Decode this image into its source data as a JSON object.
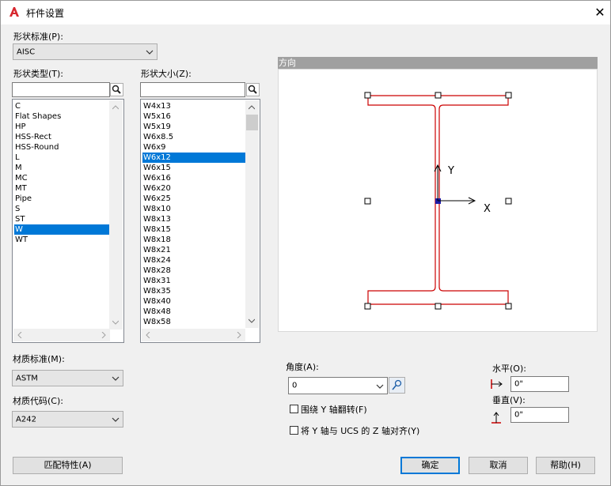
{
  "window": {
    "title": "杆件设置",
    "close_label": "✕"
  },
  "shape_standard": {
    "label": "形状标准(P):",
    "value": "AISC"
  },
  "shape_type": {
    "label": "形状类型(T):",
    "search_value": "",
    "items": [
      "C",
      "Flat Shapes",
      "HP",
      "HSS-Rect",
      "HSS-Round",
      "L",
      "M",
      "MC",
      "MT",
      "Pipe",
      "S",
      "ST",
      "W",
      "WT"
    ],
    "selected": "W"
  },
  "shape_size": {
    "label": "形状大小(Z):",
    "search_value": "",
    "items": [
      "W4x13",
      "W5x16",
      "W5x19",
      "W6x8.5",
      "W6x9",
      "W6x12",
      "W6x15",
      "W6x16",
      "W6x20",
      "W6x25",
      "W8x10",
      "W8x13",
      "W8x15",
      "W8x18",
      "W8x21",
      "W8x24",
      "W8x28",
      "W8x31",
      "W8x35",
      "W8x40",
      "W8x48",
      "W8x58"
    ],
    "selected": "W6x12"
  },
  "orientation": {
    "label": "方向",
    "axis_y": "Y",
    "axis_x": "X",
    "outline_color": "#cc0000"
  },
  "material_standard": {
    "label": "材质标准(M):",
    "value": "ASTM"
  },
  "material_code": {
    "label": "材质代码(C):",
    "value": "A242"
  },
  "angle": {
    "label": "角度(A):",
    "value": "0"
  },
  "flip_y": {
    "label": "围绕 Y 轴翻转(F)",
    "checked": false
  },
  "align_y_z": {
    "label": "将 Y 轴与 UCS 的 Z 轴对齐(Y)",
    "checked": false
  },
  "offset": {
    "horizontal_label": "水平(O):",
    "horizontal_value": "0\"",
    "vertical_label": "垂直(V):",
    "vertical_value": "0\""
  },
  "buttons": {
    "match": "匹配特性(A)",
    "ok": "确定",
    "cancel": "取消",
    "help": "帮助(H)"
  },
  "colors": {
    "accent": "#0078d7",
    "app_red": "#d7282f"
  }
}
